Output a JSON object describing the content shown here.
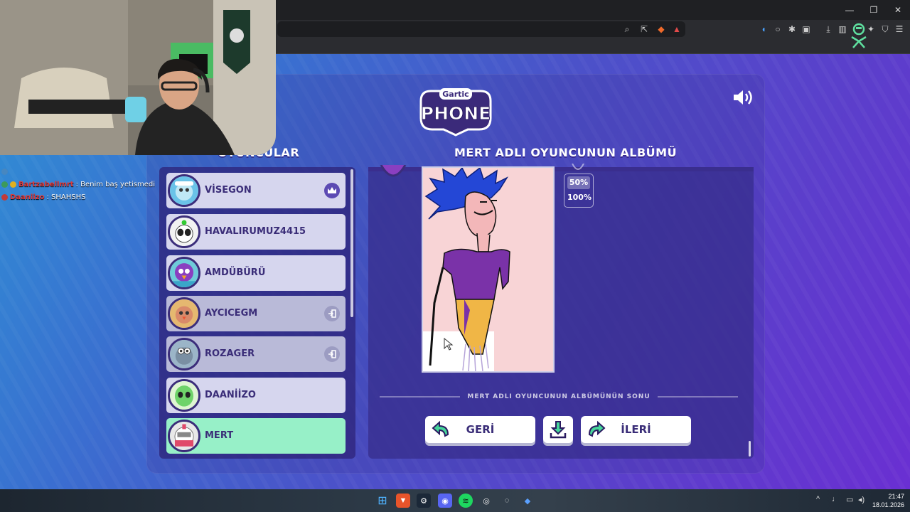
{
  "window_controls": {
    "minimize": "—",
    "restore": "❐",
    "close": "✕"
  },
  "game": {
    "logo_top": "Gartic",
    "logo_main": "PHONE",
    "players_heading": "OYUNCULAR",
    "album_heading": "MERT ADLI OYUNCUNUN ALBÜMÜ",
    "players": [
      {
        "name": "VİSEGON",
        "badge": "crown"
      },
      {
        "name": "HAVALIRUMUZ4415",
        "badge": ""
      },
      {
        "name": "AMDÜBÜRÜ",
        "badge": ""
      },
      {
        "name": "AYCICEGM",
        "badge": "left"
      },
      {
        "name": "ROZAGER",
        "badge": "left"
      },
      {
        "name": "DAANİİZO",
        "badge": ""
      },
      {
        "name": "MERT",
        "badge": ""
      }
    ],
    "zoom_options": [
      "50%",
      "100%"
    ],
    "album_end_text": "MERT ADLI OYUNCUNUN ALBÜMÜNÜN SONU",
    "back_button": "GERİ",
    "next_button": "İLERİ"
  },
  "chat": [
    {
      "user": "Bartzabellmrt",
      "message": ": Benim baş yetismedi"
    },
    {
      "user": "Daaniizo",
      "message": ": SHAHSHS"
    }
  ],
  "taskbar": {
    "time": "21:47",
    "date": "18.01.2026"
  },
  "colors": {
    "accent_purple": "#3a2d78",
    "current_player": "#97f0c8",
    "player_row": "#d6d6ee"
  }
}
